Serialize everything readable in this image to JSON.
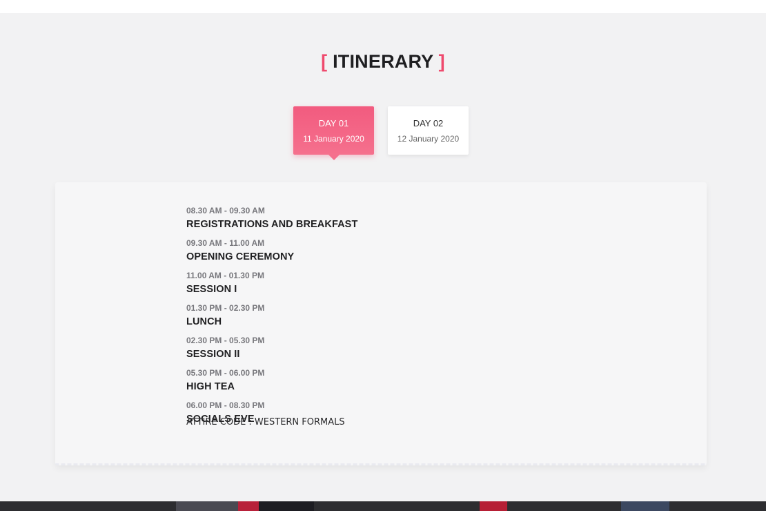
{
  "heading": {
    "open": "[",
    "text": "ITINERARY",
    "close": "]"
  },
  "tabs": [
    {
      "day": "DAY 01",
      "date": "11 January 2020",
      "active": true
    },
    {
      "day": "DAY 02",
      "date": "12 January 2020",
      "active": false
    }
  ],
  "schedule": [
    {
      "time": "08.30 AM - 09.30 AM",
      "title": "REGISTRATIONS AND BREAKFAST"
    },
    {
      "time": "09.30 AM - 11.00 AM",
      "title": "OPENING CEREMONY"
    },
    {
      "time": "11.00 AM - 01.30 PM",
      "title": "SESSION I"
    },
    {
      "time": "01.30 PM - 02.30 PM",
      "title": "LUNCH"
    },
    {
      "time": "02.30 PM - 05.30 PM",
      "title": "SESSION II"
    },
    {
      "time": "05.30 PM - 06.00 PM",
      "title": "HIGH TEA"
    },
    {
      "time": "06.00 PM - 08.30 PM",
      "title": "SOCIALS EVE"
    }
  ],
  "note": "ATTIRE CODE : WESTERN FORMALS",
  "colors": {
    "accent": "#ef4a6d",
    "background": "#f2f2f3",
    "card": "#f6f6f7"
  }
}
